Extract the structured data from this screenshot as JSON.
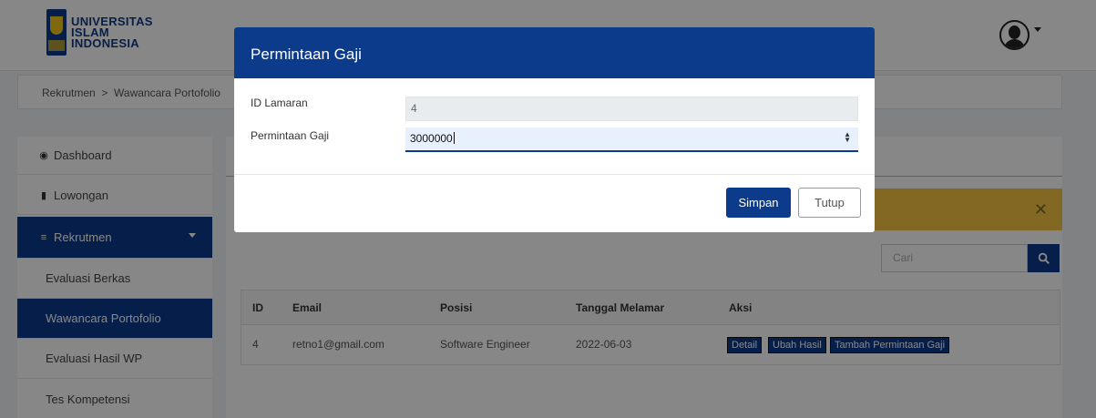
{
  "header": {
    "logo_line1": "UNIVERSITAS",
    "logo_line2": "ISLAM",
    "logo_line3": "INDONESIA",
    "user_icon": "user-circle-icon"
  },
  "breadcrumb": "Rekrutmen  >  Wawancara Portofolio",
  "sidebar": {
    "items": [
      {
        "label": "Dashboard",
        "icon": "dashboard-icon"
      },
      {
        "label": "Lowongan",
        "icon": "briefcase-icon"
      },
      {
        "label": "Rekrutmen",
        "icon": "list-icon"
      },
      {
        "label": "Evaluasi Berkas"
      },
      {
        "label": "Wawancara Portofolio"
      },
      {
        "label": "Evaluasi Hasil WP"
      },
      {
        "label": "Tes Kompetensi"
      }
    ]
  },
  "main": {
    "search_placeholder": "Cari",
    "table": {
      "headers": [
        "ID",
        "Email",
        "Posisi",
        "Tanggal Melamar",
        "Aksi"
      ],
      "rows": [
        {
          "id": "4",
          "email": "retno1@gmail.com",
          "posisi": "Software Engineer",
          "tanggal": "2022-06-03"
        }
      ],
      "actions": [
        "Detail",
        "Ubah Hasil",
        "Tambah Permintaan Gaji"
      ]
    }
  },
  "modal": {
    "title": "Permintaan Gaji",
    "fields": [
      {
        "label": "ID Lamaran",
        "value": "4"
      },
      {
        "label": "Permintaan Gaji",
        "value": "3000000"
      }
    ],
    "save_label": "Simpan",
    "close_label": "Tutup"
  }
}
